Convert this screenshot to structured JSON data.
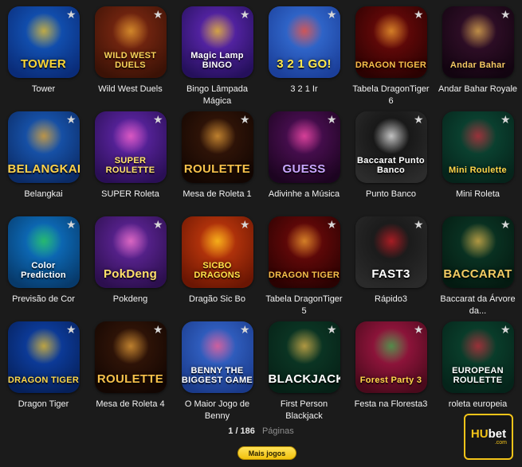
{
  "games": [
    {
      "label": "Tower",
      "art_text": "TOWER",
      "bg": "#1560c9",
      "bg2": "#0a2c79",
      "accent": "#f6c21b",
      "text_color": "#f9d433"
    },
    {
      "label": "Wild West Duels",
      "art_text": "WILD WEST DUELS",
      "bg": "#8a2d14",
      "bg2": "#3b1206",
      "accent": "#e7a431",
      "text_color": "#f7d25a"
    },
    {
      "label": "Bingo Lâmpada Mágica",
      "art_text": "Magic Lamp BINGO",
      "bg": "#6a2cc4",
      "bg2": "#25105c",
      "accent": "#f4c91b",
      "text_color": "#ffffff"
    },
    {
      "label": "3 2 1 Ir",
      "art_text": "3 2 1 GO!",
      "bg": "#3a78e0",
      "bg2": "#1b3f9a",
      "accent": "#ff4a2b",
      "text_color": "#ffe94a"
    },
    {
      "label": "Tabela DragonTiger 6",
      "art_text": "DRAGON TIGER",
      "bg": "#7a0b0b",
      "bg2": "#2a0202",
      "accent": "#f0a530",
      "text_color": "#f7c04b"
    },
    {
      "label": "Andar Bahar Royale",
      "art_text": "Andar Bahar",
      "bg": "#3b1230",
      "bg2": "#120410",
      "accent": "#e8b64f",
      "text_color": "#f3c863"
    },
    {
      "label": "Belangkai",
      "art_text": "BELANGKAI",
      "bg": "#1c64c8",
      "bg2": "#0b2b66",
      "accent": "#f0a41d",
      "text_color": "#ffd24a"
    },
    {
      "label": "SUPER Roleta",
      "art_text": "SUPER ROULETTE",
      "bg": "#6a2bb8",
      "bg2": "#2a0f55",
      "accent": "#ff66c4",
      "text_color": "#ffe36a"
    },
    {
      "label": "Mesa de Roleta 1",
      "art_text": "ROULETTE",
      "bg": "#3d1a0a",
      "bg2": "#120602",
      "accent": "#e8a23a",
      "text_color": "#f7c14b"
    },
    {
      "label": "Adivinhe a Música",
      "art_text": "GUESS",
      "bg": "#5a1263",
      "bg2": "#1c0420",
      "accent": "#ff4fa8",
      "text_color": "#c9a7ff"
    },
    {
      "label": "Punto Banco",
      "art_text": "Baccarat Punto Banco",
      "bg": "#0d0d0d",
      "bg2": "#2c2c2c",
      "accent": "#ffffff",
      "text_color": "#ffffff"
    },
    {
      "label": "Mini Roleta",
      "art_text": "Mini Roulette",
      "bg": "#0c4f3a",
      "bg2": "#06241b",
      "accent": "#c8283a",
      "text_color": "#ffd54a"
    },
    {
      "label": "Previsão de Cor",
      "art_text": "Color Prediction",
      "bg": "#0f7fd8",
      "bg2": "#073a6b",
      "accent": "#2ecb4b",
      "text_color": "#ffffff"
    },
    {
      "label": "Pokdeng",
      "art_text": "PokDeng",
      "bg": "#6a2aa8",
      "bg2": "#2c0f4e",
      "accent": "#ff7ac9",
      "text_color": "#ffe06a"
    },
    {
      "label": "Dragão Sic Bo",
      "art_text": "SICBO DRAGONS",
      "bg": "#d4410f",
      "bg2": "#6b1603",
      "accent": "#ffd21d",
      "text_color": "#ffe24a"
    },
    {
      "label": "Tabela DragonTiger 5",
      "art_text": "DRAGON TIGER",
      "bg": "#7a0b0b",
      "bg2": "#2a0202",
      "accent": "#f0a530",
      "text_color": "#f7c04b"
    },
    {
      "label": "Rápido3",
      "art_text": "FAST3",
      "bg": "#131313",
      "bg2": "#2a2a2a",
      "accent": "#d8212a",
      "text_color": "#ffffff"
    },
    {
      "label": "Baccarat da Árvore da...",
      "art_text": "BACCARAT",
      "bg": "#0c3d2a",
      "bg2": "#041a11",
      "accent": "#e6b54a",
      "text_color": "#f3cb63"
    },
    {
      "label": "Dragon Tiger",
      "art_text": "DRAGON TIGER",
      "bg": "#0f48b8",
      "bg2": "#06205a",
      "accent": "#f6c21b",
      "text_color": "#ffd84a"
    },
    {
      "label": "Mesa de Roleta 4",
      "art_text": "ROULETTE",
      "bg": "#3d1a0a",
      "bg2": "#120602",
      "accent": "#e8a23a",
      "text_color": "#f7c14b"
    },
    {
      "label": "O Maior Jogo de Benny",
      "art_text": "BENNY THE BIGGEST GAME",
      "bg": "#3a6fd8",
      "bg2": "#1a3a8a",
      "accent": "#ff5a8a",
      "text_color": "#ffffff"
    },
    {
      "label": "First Person Blackjack",
      "art_text": "BLACKJACK",
      "bg": "#0d3f2a",
      "bg2": "#062016",
      "accent": "#e6b54a",
      "text_color": "#ffffff"
    },
    {
      "label": "Festa na Floresta3",
      "art_text": "Forest Party 3",
      "bg": "#b0194a",
      "bg2": "#4a0a1c",
      "accent": "#33b24a",
      "text_color": "#ffd84a"
    },
    {
      "label": "roleta europeia",
      "art_text": "EUROPEAN ROULETTE",
      "bg": "#0c4a33",
      "bg2": "#05241a",
      "accent": "#c8283a",
      "text_color": "#ffffff"
    }
  ],
  "pager": {
    "count": "1 / 186",
    "word": "Páginas"
  },
  "more_button": "Mais jogos",
  "badge": {
    "hu": "HU",
    "bet": "bet",
    "domain": ".com"
  }
}
